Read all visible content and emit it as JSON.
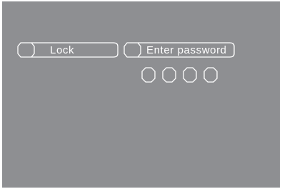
{
  "lock_button": {
    "label": "Lock"
  },
  "password_field": {
    "label": "Enter password",
    "digit_slots": 4,
    "entered_digits": 0
  },
  "colors": {
    "screen_background": "#8e8f92",
    "outline": "#ffffff"
  }
}
